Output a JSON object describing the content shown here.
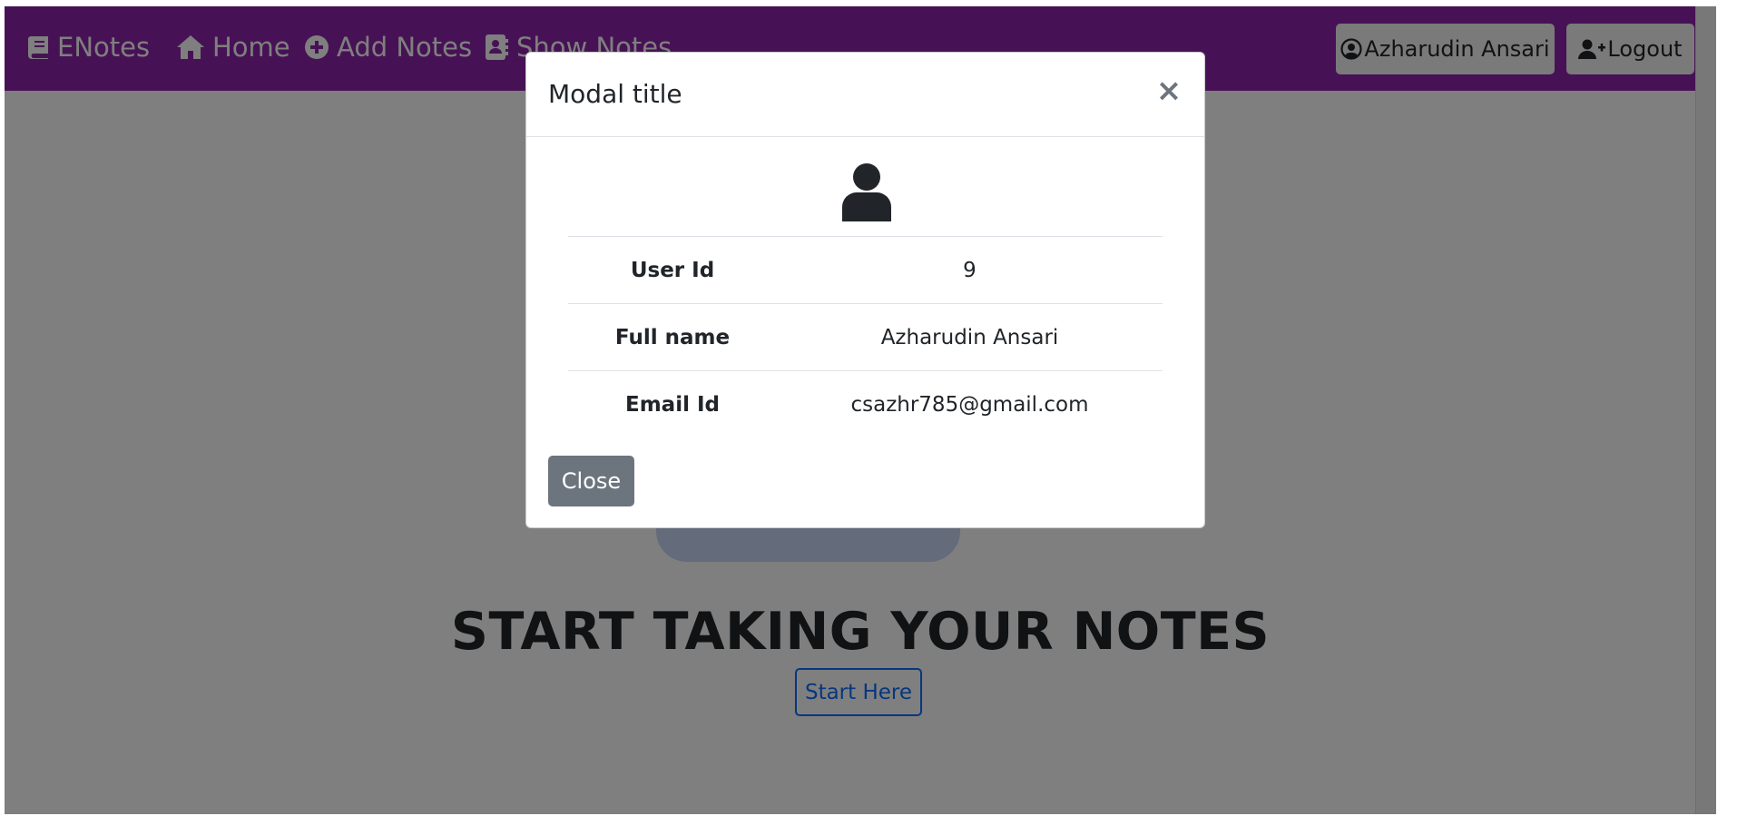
{
  "navbar": {
    "brand": "ENotes",
    "home": "Home",
    "add_notes": "Add Notes",
    "show_notes": "Show Notes",
    "user_button": "Azharudin Ansari",
    "logout_button": "Logout"
  },
  "hero": {
    "title": "START TAKING YOUR NOTES",
    "button": "Start Here"
  },
  "modal": {
    "title": "Modal title",
    "close_symbol": "×",
    "rows": [
      {
        "label": "User Id",
        "value": "9"
      },
      {
        "label": "Full name",
        "value": "Azharudin Ansari"
      },
      {
        "label": "Email Id",
        "value": "csazhr785@gmail.com"
      }
    ],
    "close_button": "Close"
  },
  "colors": {
    "navbar": "#8e24aa",
    "primary": "#0d6efd",
    "secondary": "#6c757d"
  },
  "icons": [
    "book-icon",
    "home-icon",
    "plus-circle-icon",
    "address-card-icon",
    "user-circle-icon",
    "user-plus-icon",
    "user-icon",
    "close-icon"
  ]
}
